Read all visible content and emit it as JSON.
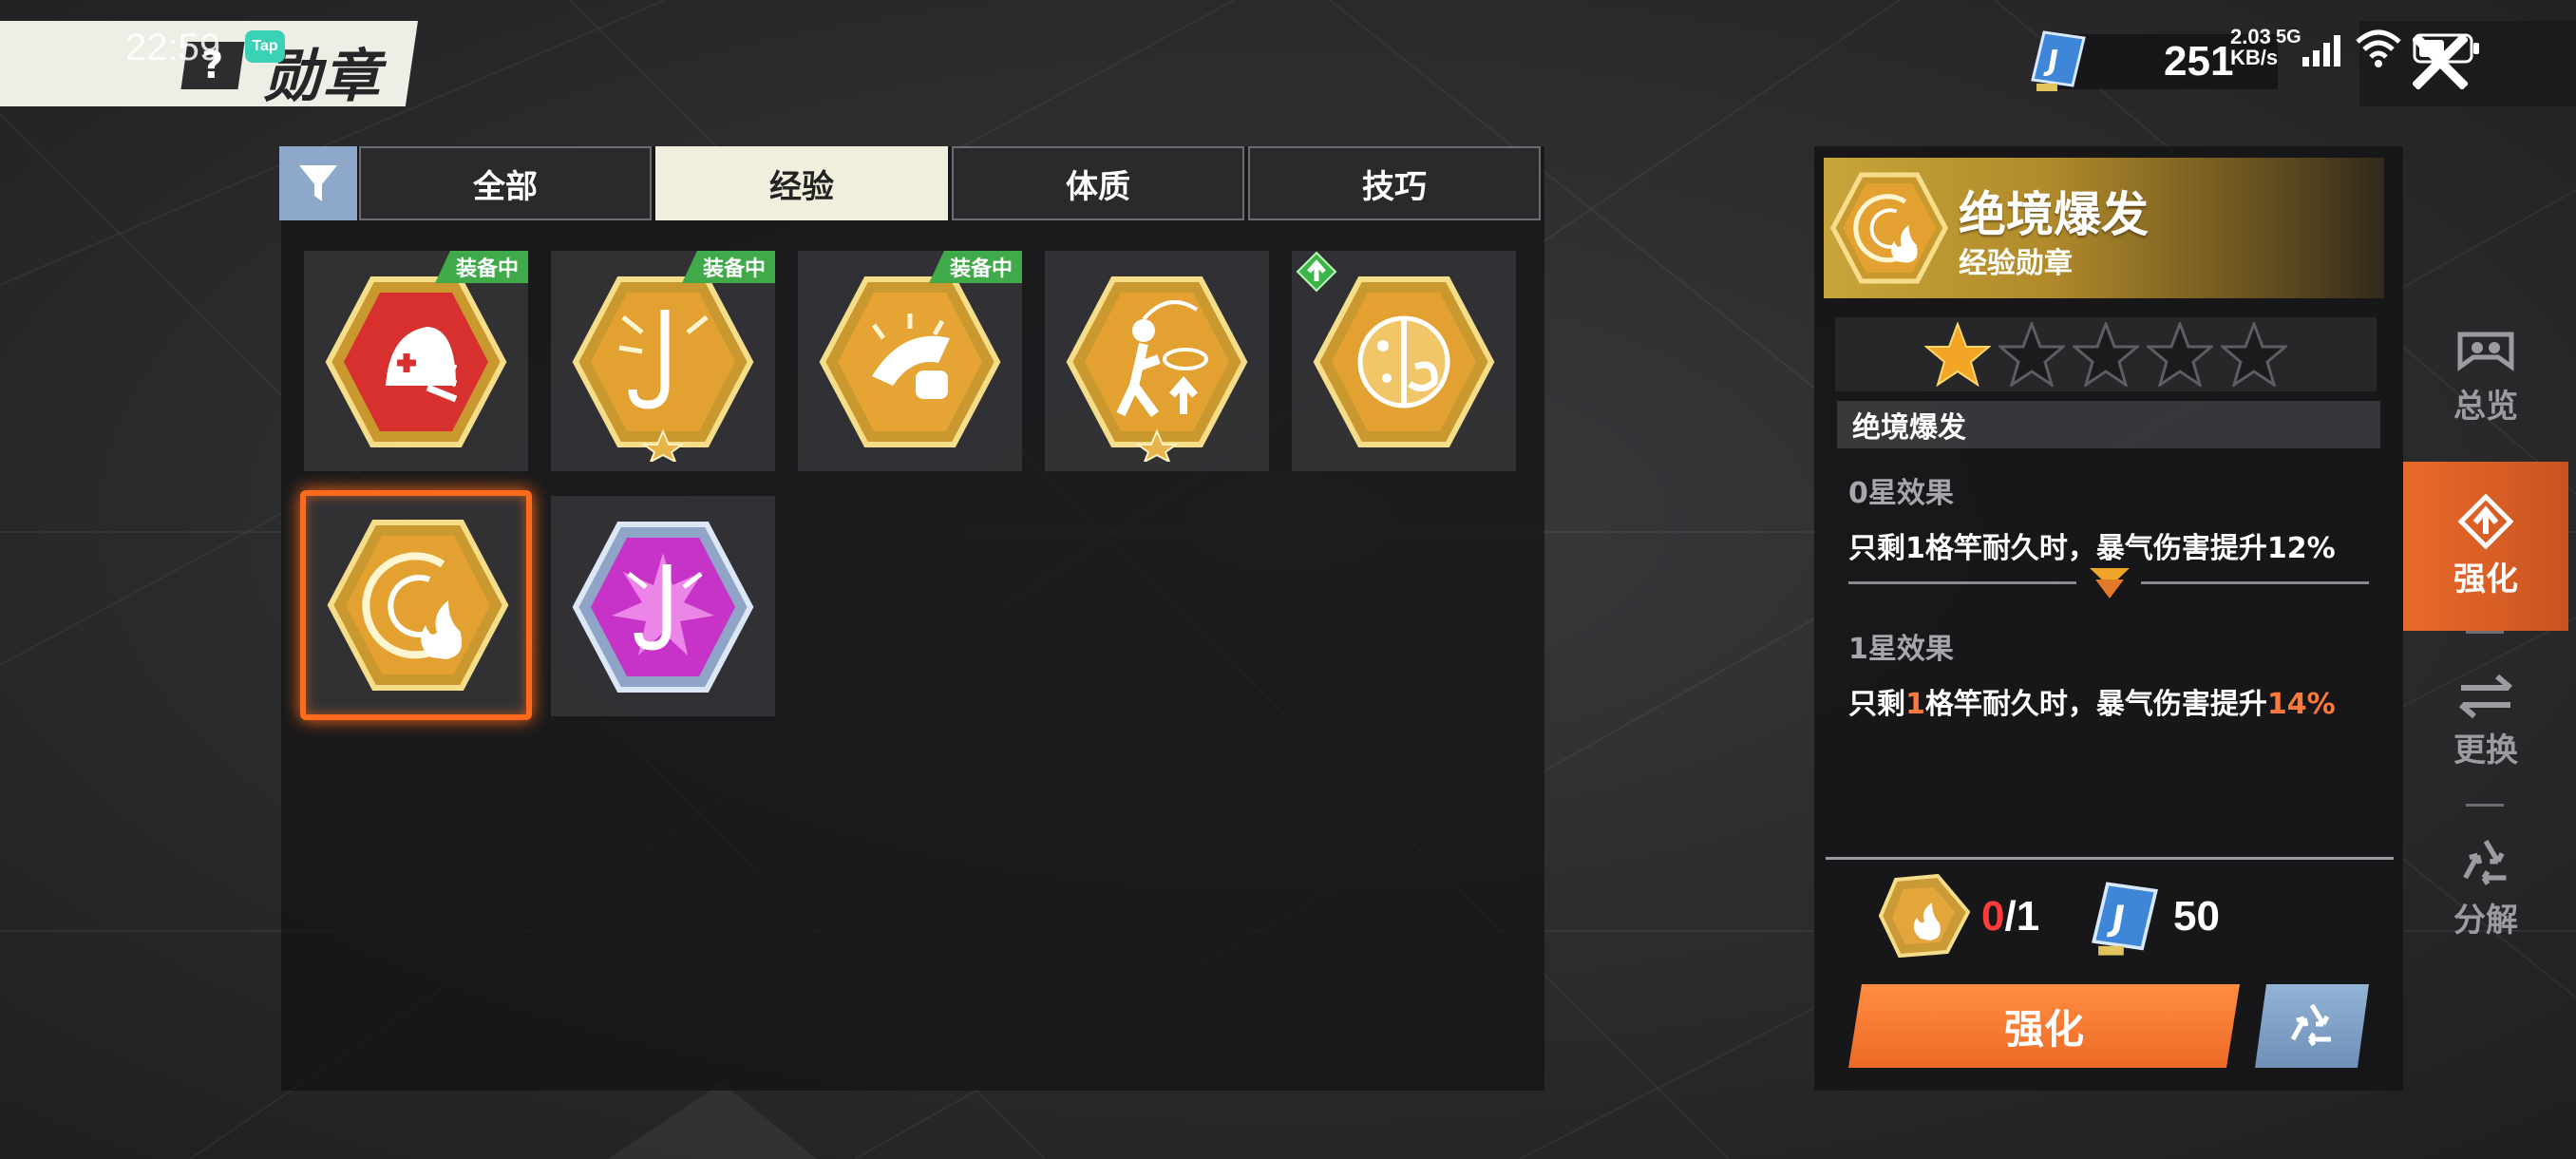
{
  "status_bar": {
    "time": "22:59",
    "tap_badge": "Tap",
    "net_speed_value": "2.03",
    "net_speed_unit": "KB/s",
    "net_type": "5G"
  },
  "header": {
    "help_glyph": "?",
    "title": "勋章"
  },
  "currency": {
    "icon": "blue-j-card-icon",
    "value": "251"
  },
  "tabs": [
    {
      "label": "全部",
      "active": false
    },
    {
      "label": "经验",
      "active": true
    },
    {
      "label": "体质",
      "active": false
    },
    {
      "label": "技巧",
      "active": false
    }
  ],
  "equipped_label": "装备中",
  "medals": [
    {
      "icon": "red-shield-medal-icon",
      "equipped": true,
      "starred": false
    },
    {
      "icon": "gold-fishhook-medal-icon",
      "equipped": true,
      "starred": true
    },
    {
      "icon": "gold-fish-fist-medal-icon",
      "equipped": true,
      "starred": false
    },
    {
      "icon": "gold-angler-up-medal-icon",
      "equipped": false,
      "starred": true
    },
    {
      "icon": "gold-lure-medal-icon",
      "equipped": false,
      "upgradeable": true
    },
    {
      "icon": "gold-flame-medal-icon",
      "selected": true
    },
    {
      "icon": "purple-hook-medal-icon"
    }
  ],
  "detail": {
    "name": "绝境爆发",
    "type": "经验勋章",
    "stars_filled": 1,
    "stars_total": 5,
    "effect_title": "绝境爆发",
    "star0_label": "0星效果",
    "star0_text": "只剩1格竿耐久时，暴气伤害提升12%",
    "star1_label": "1星效果",
    "star1_text_a": "只剩",
    "star1_text_num": "1",
    "star1_text_b": "格竿耐久时，暴气伤害提升",
    "star1_text_pct": "14%",
    "material_have": "0",
    "material_need": "/1",
    "cost": "50",
    "upgrade_label": "强化"
  },
  "side_nav": [
    {
      "label": "总览",
      "icon": "eye-mask-icon",
      "active": false
    },
    {
      "label": "强化",
      "icon": "upgrade-arrow-icon",
      "active": true
    },
    {
      "label": "更换",
      "icon": "swap-arrows-icon",
      "active": false
    },
    {
      "label": "分解",
      "icon": "recycle-icon",
      "active": false
    }
  ],
  "colors": {
    "accent_orange": "#ed6a26",
    "equipped_green": "#40a94a",
    "tab_active": "#f0eedd",
    "filter_blue": "#8da8c8",
    "gold_header": "#c8a43a"
  }
}
